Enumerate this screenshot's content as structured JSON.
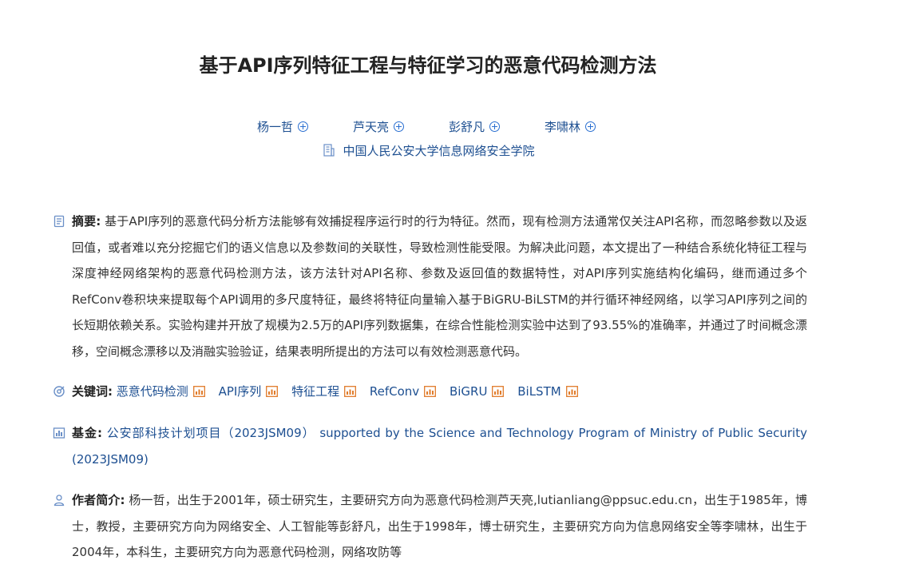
{
  "title": "基于API序列特征工程与特征学习的恶意代码检测方法",
  "authors": [
    {
      "name": "杨一哲"
    },
    {
      "name": "芦天亮"
    },
    {
      "name": "彭舒凡"
    },
    {
      "name": "李啸林"
    }
  ],
  "affiliation": "中国人民公安大学信息网络安全学院",
  "abstract": {
    "label": "摘要:",
    "text": "基于API序列的恶意代码分析方法能够有效捕捉程序运行时的行为特征。然而，现有检测方法通常仅关注API名称，而忽略参数以及返回值，或者难以充分挖掘它们的语义信息以及参数间的关联性，导致检测性能受限。为解决此问题，本文提出了一种结合系统化特征工程与深度神经网络架构的恶意代码检测方法，该方法针对API名称、参数及返回值的数据特性，对API序列实施结构化编码，继而通过多个RefConv卷积块来提取每个API调用的多尺度特征，最终将特征向量输入基于BiGRU-BiLSTM的并行循环神经网络，以学习API序列之间的长短期依赖关系。实验构建并开放了规模为2.5万的API序列数据集，在综合性能检测实验中达到了93.55%的准确率，并通过了时间概念漂移，空间概念漂移以及消融实验验证，结果表明所提出的方法可以有效检测恶意代码。"
  },
  "keywords": {
    "label": "关键词:",
    "items": [
      "恶意代码检测",
      "API序列",
      "特征工程",
      "RefConv",
      "BiGRU",
      "BiLSTM"
    ]
  },
  "fund": {
    "label": "基金:",
    "text": "公安部科技计划项目（2023JSM09） supported by the Science and Technology Program of Ministry of Public Security (2023JSM09)"
  },
  "bio": {
    "label": "作者简介:",
    "text": "杨一哲，出生于2001年，硕士研究生，主要研究方向为恶意代码检测芦天亮,lutianliang@ppsuc.edu.cn，出生于1985年，博士，教授，主要研究方向为网络安全、人工智能等彭舒凡，出生于1998年，博士研究生，主要研究方向为信息网络安全等李啸林，出生于2004年，本科生，主要研究方向为恶意代码检测，网络攻防等"
  },
  "colors": {
    "link": "#1d4f91",
    "icon_blue": "#2a6fd1",
    "icon_orange": "#e07b2a"
  },
  "icons": [
    "plus-circle-icon",
    "building-icon",
    "document-icon",
    "tag-icon",
    "chart-icon",
    "person-icon"
  ]
}
